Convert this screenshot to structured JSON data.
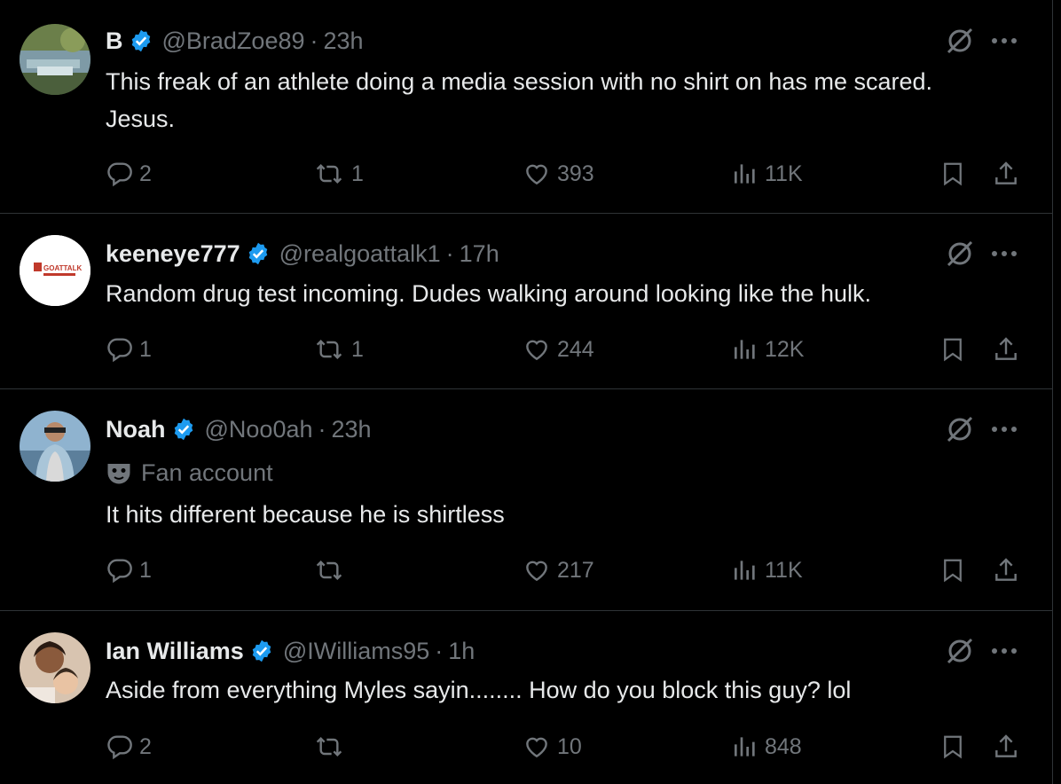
{
  "tweets": [
    {
      "name": "B",
      "handle": "@BradZoe89",
      "time": "23h",
      "text": "This freak of an athlete doing a media session with no shirt on has me scared.  Jesus.",
      "replies": "2",
      "retweets": "1",
      "likes": "393",
      "views": "11K"
    },
    {
      "name": "keeneye777",
      "handle": "@realgoattalk1",
      "time": "17h",
      "text": "Random drug test incoming. Dudes walking around looking like the hulk.",
      "replies": "1",
      "retweets": "1",
      "likes": "244",
      "views": "12K",
      "avatar_text": "GOATTALK"
    },
    {
      "name": "Noah",
      "handle": "@Noo0ah",
      "time": "23h",
      "label": "Fan account",
      "text": "It hits different because he is shirtless",
      "replies": "1",
      "retweets": "",
      "likes": "217",
      "views": "11K"
    },
    {
      "name": "Ian Williams",
      "handle": "@IWilliams95",
      "time": "1h",
      "text": "Aside from everything Myles sayin........ How do you block this guy?  lol",
      "replies": "2",
      "retweets": "",
      "likes": "10",
      "views": "848"
    }
  ],
  "separator": "·",
  "colors": {
    "background": "#000000",
    "text": "#e7e9ea",
    "secondary": "#71767b",
    "verified": "#1d9bf0",
    "divider": "#2f3336"
  }
}
